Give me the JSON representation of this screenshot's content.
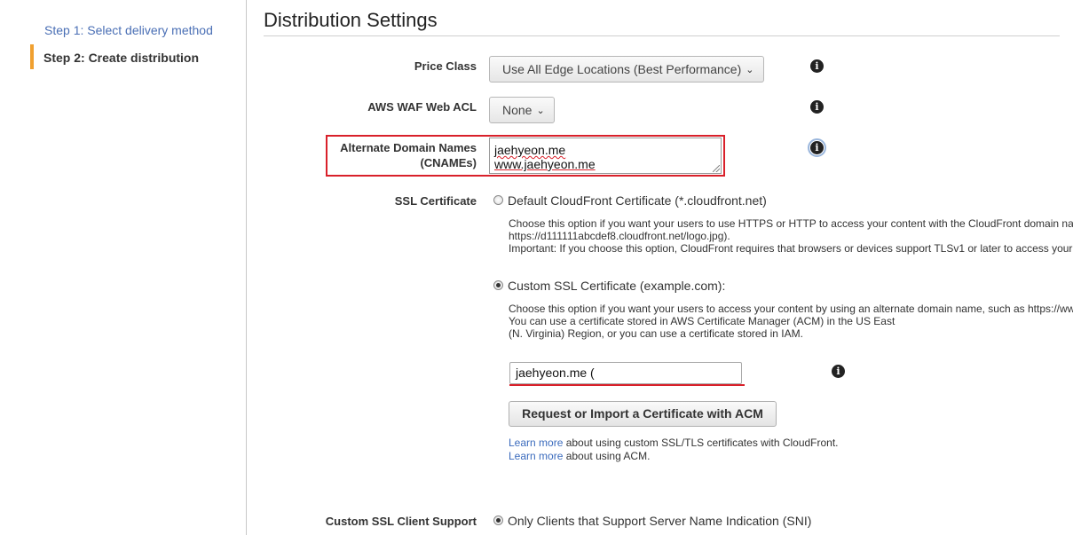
{
  "sidebar": {
    "step1": "Step 1: Select delivery method",
    "step2": "Step 2: Create distribution"
  },
  "page": {
    "heading": "Distribution Settings"
  },
  "price_class": {
    "label": "Price Class",
    "value": "Use All Edge Locations (Best Performance)"
  },
  "waf": {
    "label": "AWS WAF Web ACL",
    "value": "None"
  },
  "cnames": {
    "label_line1": "Alternate Domain Names",
    "label_line2": "(CNAMEs)",
    "values": [
      "jaehyeon.me",
      "www.jaehyeon.me"
    ]
  },
  "ssl": {
    "label": "SSL Certificate",
    "default_option": {
      "label": "Default CloudFront Certificate (*.cloudfront.net)",
      "selected": false,
      "desc": [
        "Choose this option if you want your users to use HTTPS or HTTP to access your content with the CloudFront domain na",
        "https://d111111abcdef8.cloudfront.net/logo.jpg).",
        "Important: If you choose this option, CloudFront requires that browsers or devices support TLSv1 or later to access your"
      ]
    },
    "custom_option": {
      "label": "Custom SSL Certificate (example.com):",
      "selected": true,
      "desc": [
        "Choose this option if you want your users to access your content by using an alternate domain name, such as https://ww",
        "You can use a certificate stored in AWS Certificate Manager (ACM) in the US East",
        "(N. Virginia) Region, or you can use a certificate stored in IAM."
      ]
    },
    "certificate_value": "jaehyeon.me (",
    "acm_button": "Request or Import a Certificate with ACM",
    "learn1": {
      "link": "Learn more",
      "text": " about using custom SSL/TLS certificates with CloudFront."
    },
    "learn2": {
      "link": "Learn more",
      "text": " about using ACM."
    }
  },
  "client_support": {
    "label": "Custom SSL Client Support",
    "option": "Only Clients that Support Server Name Indication (SNI)",
    "selected": true
  },
  "icons": {
    "info": "info-icon",
    "chevron": "chevron-down-icon",
    "info_glyph": "i",
    "chevron_glyph": "⌄"
  },
  "colors": {
    "highlight": "#d9202a",
    "link": "#3b6bbd",
    "step_accent": "#f0a030"
  }
}
